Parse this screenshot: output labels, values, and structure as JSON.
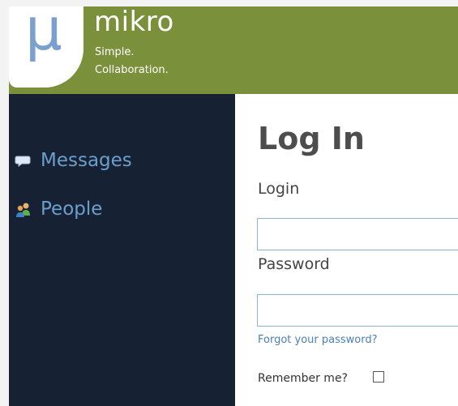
{
  "brand": {
    "logo_glyph": "μ",
    "name": "mikro",
    "tagline_line1": "Simple.",
    "tagline_line2": "Collaboration."
  },
  "colors": {
    "header": "#7a903b",
    "sidebar": "#162233",
    "nav_text": "#6c9fcc",
    "logo_glyph": "#7ba0cf",
    "link": "#4a7fb8"
  },
  "sidebar": {
    "items": [
      {
        "label": "Messages",
        "icon": "speech-bubble-icon"
      },
      {
        "label": "People",
        "icon": "people-icon"
      }
    ]
  },
  "login_form": {
    "title": "Log In",
    "login_label": "Login",
    "login_value": "",
    "password_label": "Password",
    "password_value": "",
    "forgot_link": "Forgot your password?",
    "remember_label": "Remember me?",
    "remember_checked": false
  }
}
